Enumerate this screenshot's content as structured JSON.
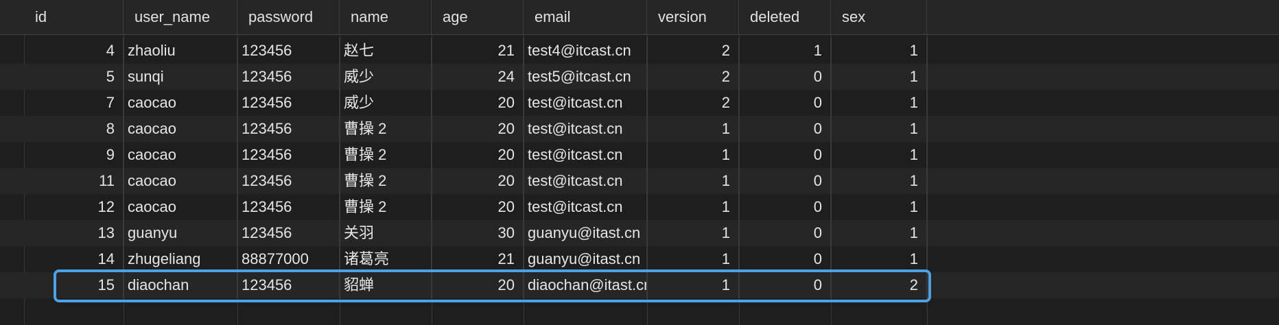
{
  "columns": [
    "id",
    "user_name",
    "password",
    "name",
    "age",
    "email",
    "version",
    "deleted",
    "sex"
  ],
  "rows": [
    {
      "id": "4",
      "user_name": "zhaoliu",
      "password": "123456",
      "name": "赵七",
      "age": "21",
      "email": "test4@itcast.cn",
      "version": "2",
      "deleted": "1",
      "sex": "1"
    },
    {
      "id": "5",
      "user_name": "sunqi",
      "password": "123456",
      "name": "威少",
      "age": "24",
      "email": "test5@itcast.cn",
      "version": "2",
      "deleted": "0",
      "sex": "1"
    },
    {
      "id": "7",
      "user_name": "caocao",
      "password": "123456",
      "name": "威少",
      "age": "20",
      "email": "test@itcast.cn",
      "version": "2",
      "deleted": "0",
      "sex": "1"
    },
    {
      "id": "8",
      "user_name": "caocao",
      "password": "123456",
      "name": "曹操 2",
      "age": "20",
      "email": "test@itcast.cn",
      "version": "1",
      "deleted": "0",
      "sex": "1"
    },
    {
      "id": "9",
      "user_name": "caocao",
      "password": "123456",
      "name": "曹操 2",
      "age": "20",
      "email": "test@itcast.cn",
      "version": "1",
      "deleted": "0",
      "sex": "1"
    },
    {
      "id": "11",
      "user_name": "caocao",
      "password": "123456",
      "name": "曹操 2",
      "age": "20",
      "email": "test@itcast.cn",
      "version": "1",
      "deleted": "0",
      "sex": "1"
    },
    {
      "id": "12",
      "user_name": "caocao",
      "password": "123456",
      "name": "曹操 2",
      "age": "20",
      "email": "test@itcast.cn",
      "version": "1",
      "deleted": "0",
      "sex": "1"
    },
    {
      "id": "13",
      "user_name": "guanyu",
      "password": "123456",
      "name": "关羽",
      "age": "30",
      "email": "guanyu@itast.cn",
      "version": "1",
      "deleted": "0",
      "sex": "1"
    },
    {
      "id": "14",
      "user_name": "zhugeliang",
      "password": "88877000",
      "name": "诸葛亮",
      "age": "21",
      "email": "guanyu@itast.cn",
      "version": "1",
      "deleted": "0",
      "sex": "1"
    },
    {
      "id": "15",
      "user_name": "diaochan",
      "password": "123456",
      "name": "貂蝉",
      "age": "20",
      "email": "diaochan@itast.cn",
      "version": "1",
      "deleted": "0",
      "sex": "2"
    }
  ],
  "selected_row_id": "15",
  "colors": {
    "background": "#1e1e1e",
    "alt_row": "#262626",
    "selection": "#4aa3e8",
    "text": "#e6e6e6"
  }
}
